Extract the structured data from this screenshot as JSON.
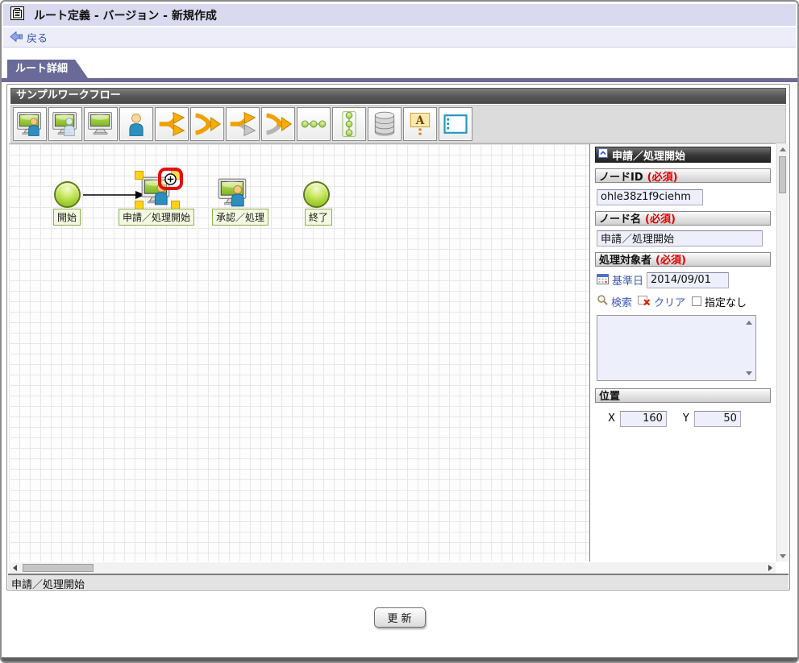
{
  "window": {
    "title": "ルート定義 - バージョン - 新規作成"
  },
  "nav": {
    "back_label": "戻る"
  },
  "tabs": {
    "detail_label": "ルート詳細"
  },
  "workflow": {
    "panel_title": "サンプルワークフロー",
    "toolbar_icons": [
      "interactive-task",
      "dynamic-task",
      "system-task",
      "user-task",
      "branch-split",
      "branch-join",
      "exclusive-split",
      "exclusive-join",
      "sequence-horizontal",
      "sequence-vertical",
      "database",
      "annotation",
      "frame"
    ],
    "nodes": [
      {
        "label": "開始",
        "type": "start"
      },
      {
        "label": "申請／処理開始",
        "type": "task",
        "selected": true
      },
      {
        "label": "承認／処理",
        "type": "task"
      },
      {
        "label": "終了",
        "type": "end"
      }
    ],
    "status_text": "申請／処理開始"
  },
  "properties": {
    "title": "申請／処理開始",
    "required_mark": "(必須)",
    "node_id": {
      "label": "ノードID",
      "value": "ohle38z1f9ciehm"
    },
    "node_name": {
      "label": "ノード名",
      "value": "申請／処理開始"
    },
    "assignee": {
      "label": "処理対象者",
      "base_date_label": "基準日",
      "base_date_value": "2014/09/01",
      "search_label": "検索",
      "clear_label": "クリア",
      "no_assign_label": "指定なし"
    },
    "position": {
      "label": "位置",
      "x_label": "X",
      "x_value": "160",
      "y_label": "Y",
      "y_value": "50"
    }
  },
  "footer": {
    "update_label": "更 新"
  }
}
